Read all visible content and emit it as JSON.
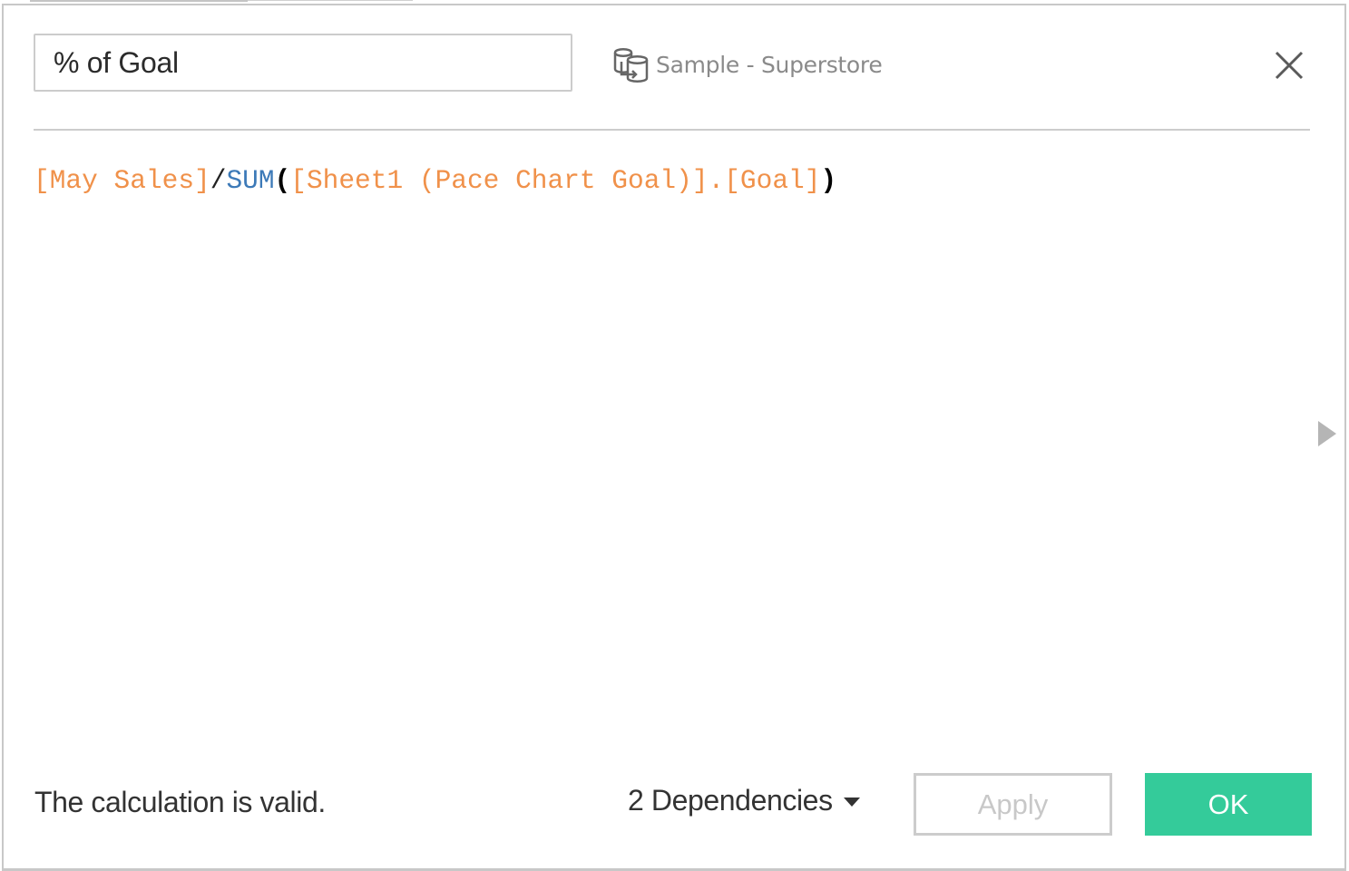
{
  "calculation": {
    "name": "% of Goal"
  },
  "datasource": {
    "icon": "data-source-icon",
    "label": "Sample - Superstore"
  },
  "close": {
    "icon": "close-icon"
  },
  "formula": {
    "tokens": [
      {
        "type": "field",
        "text": "[May Sales]"
      },
      {
        "type": "operator",
        "text": "/"
      },
      {
        "type": "function",
        "text": "SUM"
      },
      {
        "type": "paren",
        "text": "("
      },
      {
        "type": "field",
        "text": "[Sheet1 (Pace Chart Goal)].[Goal]"
      },
      {
        "type": "paren",
        "text": ")"
      }
    ]
  },
  "footer": {
    "status": "The calculation is valid.",
    "dependencies_label": "2 Dependencies",
    "apply_label": "Apply",
    "ok_label": "OK"
  },
  "colors": {
    "field": "#f0914a",
    "function": "#3d7ab8",
    "ok_button": "#34cb9a"
  }
}
